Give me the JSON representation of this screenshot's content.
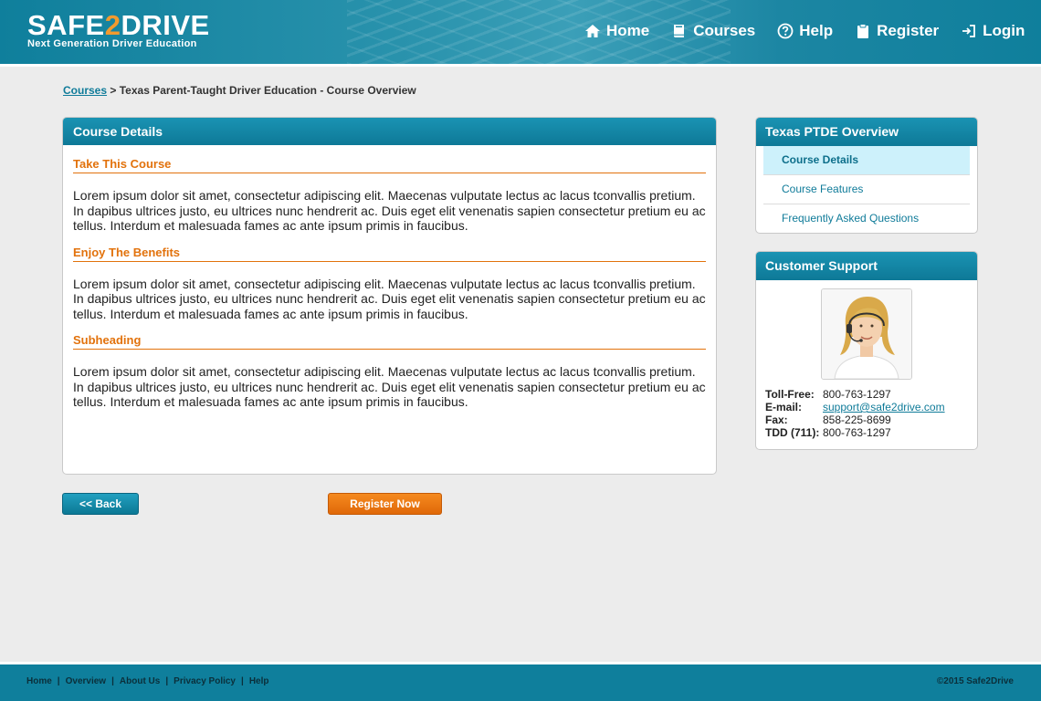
{
  "header": {
    "logo_text_pre": "SAFE",
    "logo_text_two": "2",
    "logo_text_post": "DRIVE",
    "tagline": "Next Generation Driver Education",
    "nav": [
      {
        "label": "Home",
        "icon": "home-icon"
      },
      {
        "label": "Courses",
        "icon": "book-icon"
      },
      {
        "label": "Help",
        "icon": "question-circle-icon"
      },
      {
        "label": "Register",
        "icon": "clipboard-icon"
      },
      {
        "label": "Login",
        "icon": "login-icon"
      }
    ]
  },
  "breadcrumb": {
    "link": "Courses",
    "separator": ">",
    "current": "Texas Parent-Taught Driver Education - Course Overview"
  },
  "main": {
    "title": "Course Details",
    "sections": [
      {
        "heading": "Take This Course",
        "body": "Lorem ipsum dolor sit amet, consectetur adipiscing elit. Maecenas vulputate lectus ac lacus tconvallis pretium. In dapibus ultrices justo, eu ultrices nunc hendrerit ac. Duis eget elit venenatis sapien consectetur pretium eu ac tellus. Interdum et malesuada fames ac ante ipsum primis in faucibus."
      },
      {
        "heading": "Enjoy The Benefits",
        "body": "Lorem ipsum dolor sit amet, consectetur adipiscing elit. Maecenas vulputate lectus ac lacus tconvallis pretium. In dapibus ultrices justo, eu ultrices nunc hendrerit ac. Duis eget elit venenatis sapien consectetur pretium eu ac tellus. Interdum et malesuada fames ac ante ipsum primis in faucibus."
      },
      {
        "heading": "Subheading",
        "body": "Lorem ipsum dolor sit amet, consectetur adipiscing elit. Maecenas vulputate lectus ac lacus tconvallis pretium. In dapibus ultrices justo, eu ultrices nunc hendrerit ac. Duis eget elit venenatis sapien consectetur pretium eu ac tellus. Interdum et malesuada fames ac ante ipsum primis in faucibus."
      }
    ]
  },
  "buttons": {
    "back": "<< Back",
    "register": "Register Now"
  },
  "overview": {
    "title": "Texas PTDE Overview",
    "items": [
      {
        "label": "Course Details",
        "active": true
      },
      {
        "label": "Course Features",
        "active": false
      },
      {
        "label": "Frequently Asked Questions",
        "active": false
      }
    ]
  },
  "support": {
    "title": "Customer Support",
    "toll_free_label": "Toll-Free:",
    "toll_free": "800-763-1297",
    "email_label": "E-mail:",
    "email": "support@safe2drive.com",
    "fax_label": "Fax:",
    "fax": "858-225-8699",
    "tdd_label": "TDD (711):",
    "tdd": "800-763-1297"
  },
  "footer": {
    "links": [
      "Home",
      "Overview",
      "About Us",
      "Privacy Policy",
      "Help"
    ],
    "separator": "|",
    "copyright": "©2015 Safe2Drive"
  },
  "colors": {
    "brand_teal": "#0f7f9c",
    "accent_orange": "#e2720c",
    "active_item_bg": "#cdf1fb"
  }
}
